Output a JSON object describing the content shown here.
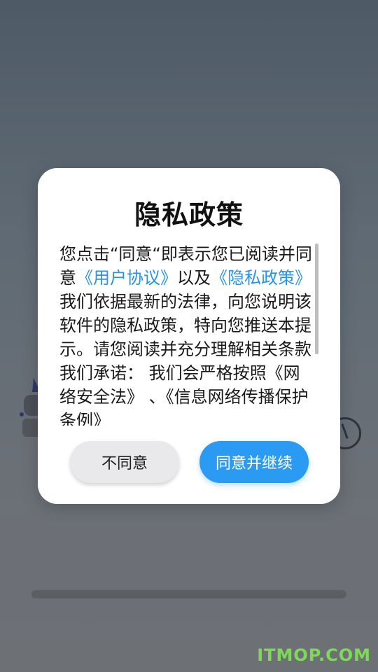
{
  "dialog": {
    "title": "隐私政策",
    "body": {
      "p1": "您点击“同意“即表示您已阅读并同意",
      "link_user_agreement": "《用户协议》",
      "p2": "以及",
      "link_privacy_policy": "《隐私政策》",
      "p3": "我们依据最新的法律，向您说明该软件的隐私政策，特向您推送本提示。请您阅读并充分理解相关条款我们承诺： 我们会严格按照《网络安全法》 、《信息网络传播保护条例》"
    },
    "buttons": {
      "disagree_label": "不同意",
      "agree_label": "同意并继续"
    }
  },
  "watermark": "ITMOP.COM",
  "colors": {
    "link": "#2a92e8",
    "primary_button": "#2b9af3",
    "secondary_button": "#e9e9ec",
    "overlay": "#5f6a74"
  }
}
